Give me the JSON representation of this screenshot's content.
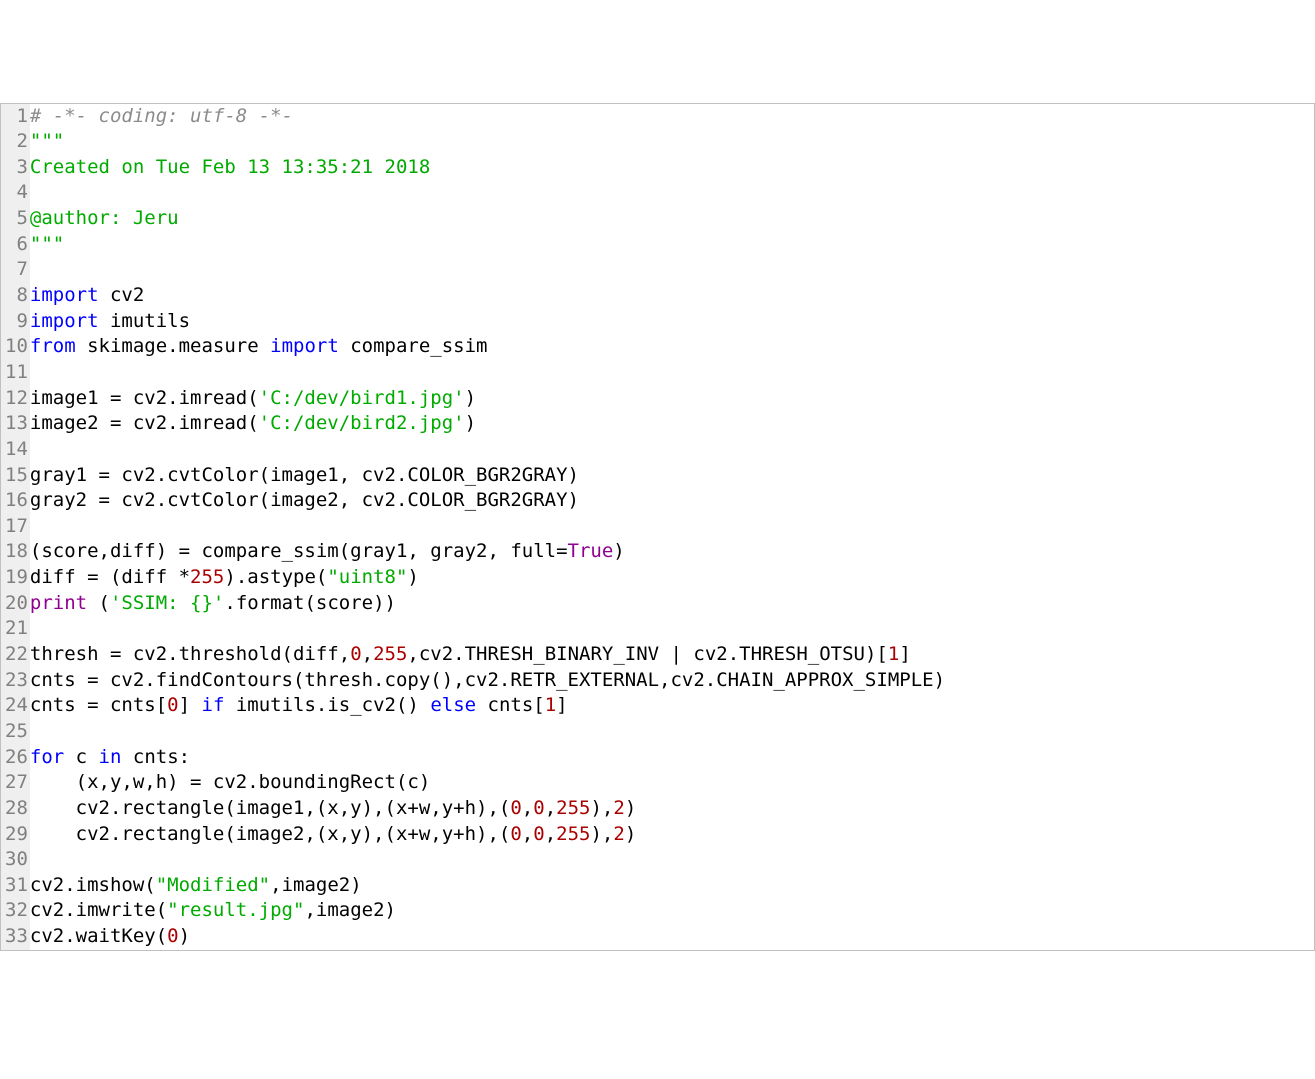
{
  "lines": [
    [
      {
        "cls": "tok-comment",
        "text": "# -*- coding: utf-8 -*-"
      }
    ],
    [
      {
        "cls": "tok-docstring",
        "text": "\"\"\""
      }
    ],
    [
      {
        "cls": "tok-docstring",
        "text": "Created on Tue Feb 13 13:35:21 2018"
      }
    ],
    [],
    [
      {
        "cls": "tok-docstring",
        "text": "@author: Jeru"
      }
    ],
    [
      {
        "cls": "tok-docstring",
        "text": "\"\"\""
      }
    ],
    [],
    [
      {
        "cls": "tok-keyword",
        "text": "import"
      },
      {
        "cls": "tok-name",
        "text": " cv2"
      }
    ],
    [
      {
        "cls": "tok-keyword",
        "text": "import"
      },
      {
        "cls": "tok-name",
        "text": " imutils"
      }
    ],
    [
      {
        "cls": "tok-keyword",
        "text": "from"
      },
      {
        "cls": "tok-name",
        "text": " skimage.measure "
      },
      {
        "cls": "tok-keyword",
        "text": "import"
      },
      {
        "cls": "tok-name",
        "text": " compare_ssim"
      }
    ],
    [],
    [
      {
        "cls": "tok-name",
        "text": "image1 = cv2.imread("
      },
      {
        "cls": "tok-string",
        "text": "'C:/dev/bird1.jpg'"
      },
      {
        "cls": "tok-name",
        "text": ")"
      }
    ],
    [
      {
        "cls": "tok-name",
        "text": "image2 = cv2.imread("
      },
      {
        "cls": "tok-string",
        "text": "'C:/dev/bird2.jpg'"
      },
      {
        "cls": "tok-name",
        "text": ")"
      }
    ],
    [],
    [
      {
        "cls": "tok-name",
        "text": "gray1 = cv2.cvtColor(image1, cv2.COLOR_BGR2GRAY)"
      }
    ],
    [
      {
        "cls": "tok-name",
        "text": "gray2 = cv2.cvtColor(image2, cv2.COLOR_BGR2GRAY)"
      }
    ],
    [],
    [
      {
        "cls": "tok-name",
        "text": "(score,diff) = compare_ssim(gray1, gray2, full="
      },
      {
        "cls": "tok-builtin",
        "text": "True"
      },
      {
        "cls": "tok-name",
        "text": ")"
      }
    ],
    [
      {
        "cls": "tok-name",
        "text": "diff = (diff *"
      },
      {
        "cls": "tok-number",
        "text": "255"
      },
      {
        "cls": "tok-name",
        "text": ").astype("
      },
      {
        "cls": "tok-string",
        "text": "\"uint8\""
      },
      {
        "cls": "tok-name",
        "text": ")"
      }
    ],
    [
      {
        "cls": "tok-builtin",
        "text": "print"
      },
      {
        "cls": "tok-name",
        "text": " ("
      },
      {
        "cls": "tok-string",
        "text": "'SSIM: {}'"
      },
      {
        "cls": "tok-name",
        "text": ".format(score))"
      }
    ],
    [],
    [
      {
        "cls": "tok-name",
        "text": "thresh = cv2.threshold(diff,"
      },
      {
        "cls": "tok-number",
        "text": "0"
      },
      {
        "cls": "tok-name",
        "text": ","
      },
      {
        "cls": "tok-number",
        "text": "255"
      },
      {
        "cls": "tok-name",
        "text": ",cv2.THRESH_BINARY_INV | cv2.THRESH_OTSU)["
      },
      {
        "cls": "tok-number",
        "text": "1"
      },
      {
        "cls": "tok-name",
        "text": "]"
      }
    ],
    [
      {
        "cls": "tok-name",
        "text": "cnts = cv2.findContours(thresh.copy(),cv2.RETR_EXTERNAL,cv2.CHAIN_APPROX_SIMPLE)"
      }
    ],
    [
      {
        "cls": "tok-name",
        "text": "cnts = cnts["
      },
      {
        "cls": "tok-number",
        "text": "0"
      },
      {
        "cls": "tok-name",
        "text": "] "
      },
      {
        "cls": "tok-keyword",
        "text": "if"
      },
      {
        "cls": "tok-name",
        "text": " imutils.is_cv2() "
      },
      {
        "cls": "tok-keyword",
        "text": "else"
      },
      {
        "cls": "tok-name",
        "text": " cnts["
      },
      {
        "cls": "tok-number",
        "text": "1"
      },
      {
        "cls": "tok-name",
        "text": "]"
      }
    ],
    [],
    [
      {
        "cls": "tok-keyword",
        "text": "for"
      },
      {
        "cls": "tok-name",
        "text": " c "
      },
      {
        "cls": "tok-keyword",
        "text": "in"
      },
      {
        "cls": "tok-name",
        "text": " cnts:"
      }
    ],
    [
      {
        "cls": "tok-name",
        "text": "    (x,y,w,h) = cv2.boundingRect(c)"
      }
    ],
    [
      {
        "cls": "tok-name",
        "text": "    cv2.rectangle(image1,(x,y),(x+w,y+h),("
      },
      {
        "cls": "tok-number",
        "text": "0"
      },
      {
        "cls": "tok-name",
        "text": ","
      },
      {
        "cls": "tok-number",
        "text": "0"
      },
      {
        "cls": "tok-name",
        "text": ","
      },
      {
        "cls": "tok-number",
        "text": "255"
      },
      {
        "cls": "tok-name",
        "text": "),"
      },
      {
        "cls": "tok-number",
        "text": "2"
      },
      {
        "cls": "tok-name",
        "text": ")"
      }
    ],
    [
      {
        "cls": "tok-name",
        "text": "    cv2.rectangle(image2,(x,y),(x+w,y+h),("
      },
      {
        "cls": "tok-number",
        "text": "0"
      },
      {
        "cls": "tok-name",
        "text": ","
      },
      {
        "cls": "tok-number",
        "text": "0"
      },
      {
        "cls": "tok-name",
        "text": ","
      },
      {
        "cls": "tok-number",
        "text": "255"
      },
      {
        "cls": "tok-name",
        "text": "),"
      },
      {
        "cls": "tok-number",
        "text": "2"
      },
      {
        "cls": "tok-name",
        "text": ")"
      }
    ],
    [],
    [
      {
        "cls": "tok-name",
        "text": "cv2.imshow("
      },
      {
        "cls": "tok-string",
        "text": "\"Modified\""
      },
      {
        "cls": "tok-name",
        "text": ",image2)"
      }
    ],
    [
      {
        "cls": "tok-name",
        "text": "cv2.imwrite("
      },
      {
        "cls": "tok-string",
        "text": "\"result.jpg\""
      },
      {
        "cls": "tok-name",
        "text": ",image2)"
      }
    ],
    [
      {
        "cls": "tok-name",
        "text": "cv2.waitKey("
      },
      {
        "cls": "tok-number",
        "text": "0"
      },
      {
        "cls": "tok-name",
        "text": ")"
      }
    ]
  ]
}
